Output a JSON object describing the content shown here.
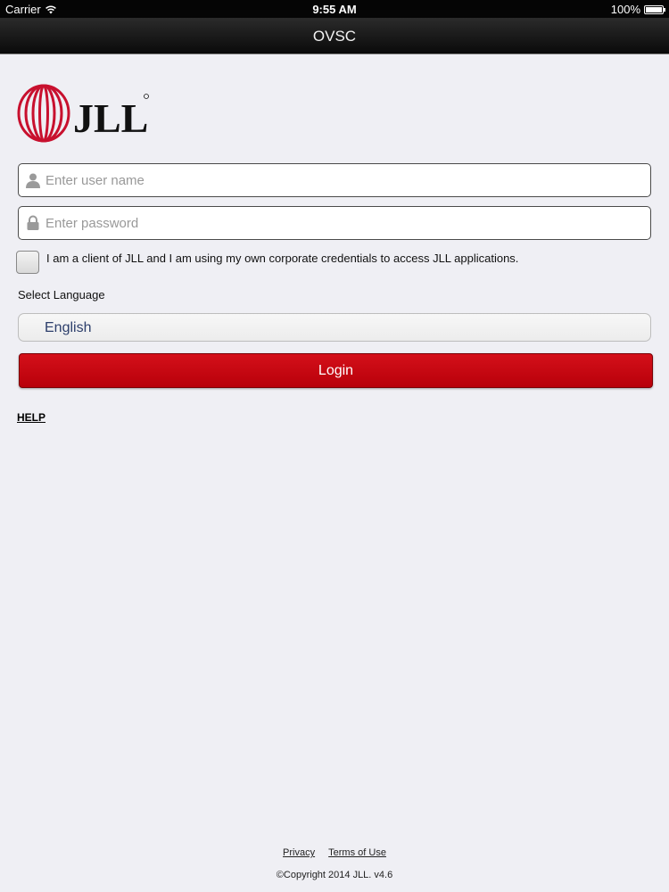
{
  "status_bar": {
    "carrier": "Carrier",
    "time": "9:55 AM",
    "battery": "100%"
  },
  "nav": {
    "title": "OVSC"
  },
  "logo": {
    "text": "JLL"
  },
  "username": {
    "placeholder": "Enter user name",
    "value": ""
  },
  "password": {
    "placeholder": "Enter password",
    "value": ""
  },
  "client_checkbox": {
    "label": "I am a client of JLL and I am using my own corporate credentials to access JLL applications.",
    "checked": false
  },
  "language": {
    "label": "Select Language",
    "selected": "English"
  },
  "login_button": {
    "label": "Login"
  },
  "help_link": "HELP",
  "footer": {
    "privacy": "Privacy",
    "terms": "Terms of Use",
    "copyright": "©Copyright 2014 JLL. v4.6"
  },
  "colors": {
    "accent_red": "#c8000f",
    "nav_bg": "#111111",
    "page_bg": "#efeff4"
  },
  "icons": {
    "wifi": "wifi-icon",
    "user": "user-icon",
    "lock": "lock-icon",
    "battery": "battery-icon"
  }
}
